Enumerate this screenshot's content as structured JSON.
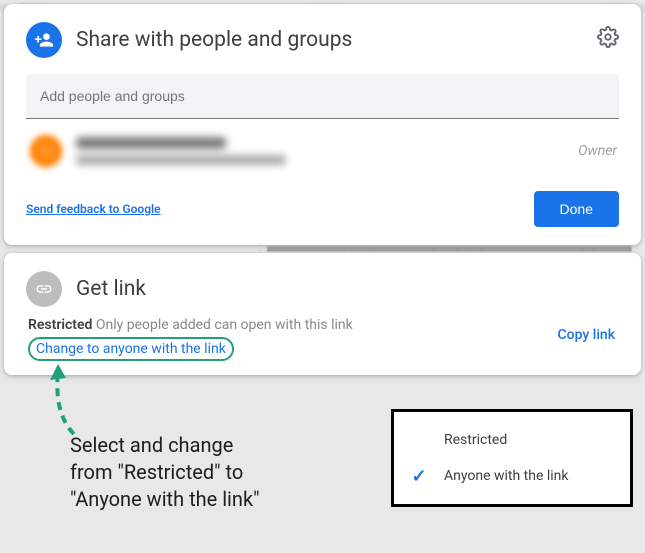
{
  "share": {
    "title": "Share with people and groups",
    "addPlaceholder": "Add people and groups",
    "role": "Owner",
    "feedback": "Send feedback to Google",
    "done": "Done"
  },
  "link": {
    "title": "Get link",
    "statusLabel": "Restricted",
    "statusDesc": " Only people added can open with this link",
    "changeText": "Change to anyone with the link",
    "copy": "Copy link"
  },
  "dropdown": {
    "opt1": "Restricted",
    "opt2": "Anyone with the link"
  },
  "annotation": {
    "line1": "Select and change",
    "line2": "from \"Restricted\" to",
    "line3": "\"Anyone with the link\""
  }
}
